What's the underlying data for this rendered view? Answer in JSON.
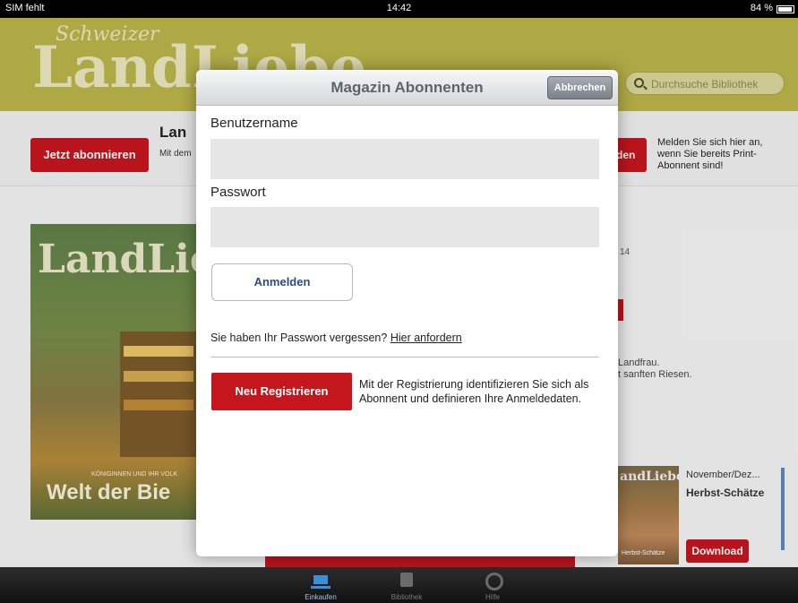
{
  "statusbar": {
    "carrier": "SIM fehlt",
    "time": "14:42",
    "battery": "84 %"
  },
  "header": {
    "logo_small": "Schweizer",
    "logo_big": "LandLiebe",
    "search_placeholder": "Durchsuche Bibliothek"
  },
  "promo": {
    "subscribe_label": "Jetzt abonnieren",
    "title_partial": "Lan",
    "sub_partial": "Mit dem",
    "login_partial": "den",
    "right_text": "Melden Sie sich hier an, wenn Sie bereits Print-Abonnent sind!"
  },
  "cover": {
    "logo": "LandLie",
    "topic": "KÖNIGINNEN UND IHR VOLK",
    "headline": "Welt der Bie"
  },
  "side": {
    "snippet1": "14",
    "desc_line1": "Landfrau.",
    "desc_line2": "t sanften Riesen."
  },
  "issue": {
    "thumb_logo": "andLiebe",
    "thumb_tag": "Herbst-Schätze",
    "date": "November/Dez...",
    "title": "Herbst-Schätze",
    "download_label": "Download"
  },
  "tabbar": {
    "tabs": [
      {
        "label": "Einkaufen",
        "icon": "cart-icon"
      },
      {
        "label": "Bibliothek",
        "icon": "library-icon"
      },
      {
        "label": "Hilfe",
        "icon": "help-icon"
      }
    ]
  },
  "modal": {
    "title": "Magazin Abonnenten",
    "cancel_label": "Abbrechen",
    "username_label": "Benutzername",
    "username_value": "",
    "password_label": "Passwort",
    "password_value": "",
    "login_label": "Anmelden",
    "forgot_text": "Sie haben Ihr Passwort vergessen?",
    "forgot_link": "Hier anfordern",
    "register_label": "Neu Registrieren",
    "register_note": "Mit der Registrierung identifizieren Sie sich als Abonnent und definieren Ihre Anmeldedaten."
  },
  "colors": {
    "brand_red": "#c5161d",
    "header_olive": "#b9b44a",
    "active_blue": "#3d8ed8"
  }
}
